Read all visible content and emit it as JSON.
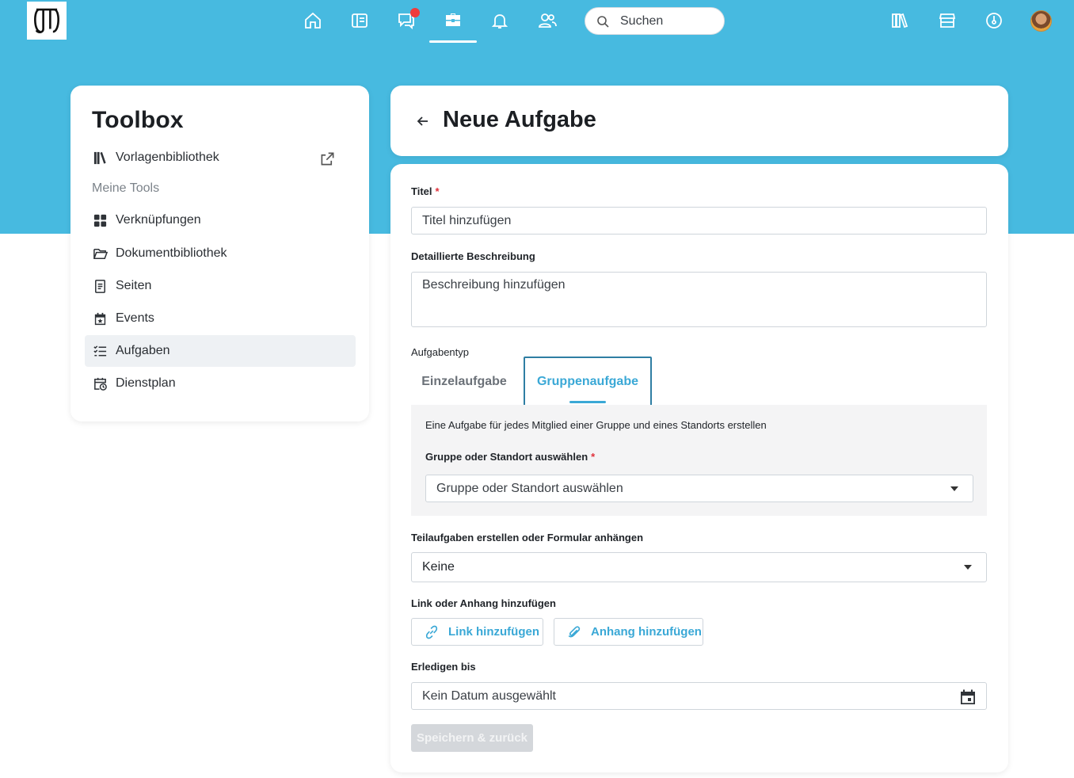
{
  "nav": {
    "search_placeholder": "Suchen",
    "accent_color": "#47bae0",
    "notification_color": "#ef3b3b",
    "icons": [
      "home-icon",
      "news-icon",
      "chat-icon",
      "toolbox-icon",
      "bell-icon",
      "people-icon",
      "library-icon",
      "store-icon",
      "dashboard-icon",
      "avatar"
    ]
  },
  "sidebar": {
    "title": "Toolbox",
    "library_item": "Vorlagenbibliothek",
    "section_label": "Meine Tools",
    "items": [
      {
        "label": "Verknüpfungen",
        "icon": "grid-icon"
      },
      {
        "label": "Dokumentbibliothek",
        "icon": "folder-icon"
      },
      {
        "label": "Seiten",
        "icon": "page-icon"
      },
      {
        "label": "Events",
        "icon": "calendar-star-icon"
      },
      {
        "label": "Aufgaben",
        "icon": "checklist-icon",
        "active": true
      },
      {
        "label": "Dienstplan",
        "icon": "calendar-clock-icon"
      }
    ]
  },
  "header": {
    "title": "Neue Aufgabe"
  },
  "form": {
    "title_label": "Titel",
    "title_placeholder": "Titel hinzufügen",
    "desc_label": "Detaillierte Beschreibung",
    "desc_placeholder": "Beschreibung hinzufügen",
    "type_label": "Aufgabentyp",
    "tabs": [
      {
        "label": "Einzelaufgabe",
        "selected": false
      },
      {
        "label": "Gruppenaufgabe",
        "selected": true
      }
    ],
    "group_desc": "Eine Aufgabe für jedes Mitglied einer Gruppe und eines Standorts erstellen",
    "group_label": "Gruppe oder Standort auswählen",
    "group_placeholder": "Gruppe oder Standort auswählen",
    "subtask_label": "Teilaufgaben erstellen oder Formular anhängen",
    "subtask_value": "Keine",
    "attach_label": "Link oder Anhang hinzufügen",
    "link_button": "Link hinzufügen",
    "attachment_button": "Anhang hinzufügen",
    "due_label": "Erledigen bis",
    "due_value": "Kein Datum ausgewählt",
    "save_button": "Speichern & zurück",
    "required_mark": "*"
  }
}
